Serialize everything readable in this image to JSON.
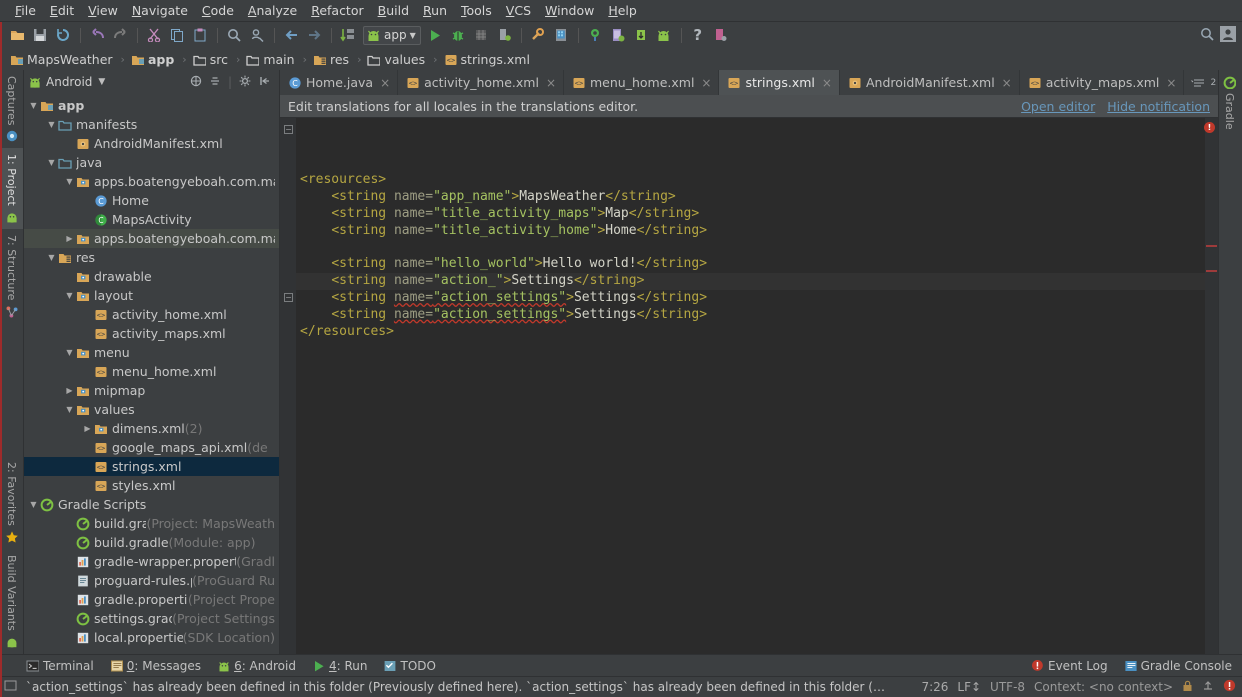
{
  "menu": {
    "items": [
      "File",
      "Edit",
      "View",
      "Navigate",
      "Code",
      "Analyze",
      "Refactor",
      "Build",
      "Run",
      "Tools",
      "VCS",
      "Window",
      "Help"
    ]
  },
  "toolbar": {
    "icons": [
      "open-folder-icon",
      "save-all-icon",
      "sync-icon",
      "undo-icon",
      "redo-icon",
      "cut-icon",
      "copy-icon",
      "paste-icon",
      "find-icon",
      "find-usages-icon",
      "back-icon",
      "forward-icon",
      "compile-icon"
    ],
    "run_config_label": "app",
    "run_icons": [
      "run-icon",
      "debug-icon",
      "coverage-icon",
      "attach-debugger-icon",
      "sdk-manager-icon",
      "avd-manager-icon",
      "sync-gradle-icon",
      "device-monitor-icon",
      "layout-inspector-icon",
      "android-icon",
      "help-icon",
      "project-structure-icon"
    ],
    "search_icon": "search-icon",
    "user_icon": "user-avatar-icon"
  },
  "breadcrumb": {
    "items": [
      {
        "label": "MapsWeather",
        "icon": "module-icon",
        "bold": false
      },
      {
        "label": "app",
        "icon": "module-icon",
        "bold": true
      },
      {
        "label": "src",
        "icon": "folder-icon",
        "bold": false
      },
      {
        "label": "main",
        "icon": "folder-icon",
        "bold": false
      },
      {
        "label": "res",
        "icon": "res-folder-icon",
        "bold": false
      },
      {
        "label": "values",
        "icon": "folder-icon",
        "bold": false
      },
      {
        "label": "strings.xml",
        "icon": "xml-file-icon",
        "bold": false
      }
    ],
    "separator": "›"
  },
  "left_rail": {
    "items": [
      {
        "label": "Captures",
        "icon": "captures-icon",
        "active": false
      },
      {
        "label": "1: Project",
        "icon": "project-icon",
        "active": true
      },
      {
        "label": "7: Structure",
        "icon": "structure-icon",
        "active": false
      },
      {
        "label": "2: Favorites",
        "icon": "favorites-star-icon",
        "active": false
      },
      {
        "label": "Build Variants",
        "icon": "build-variants-icon",
        "active": false
      }
    ]
  },
  "right_rail": {
    "items": [
      {
        "label": "Gradle",
        "icon": "gradle-icon"
      }
    ]
  },
  "project_pane": {
    "view_title": "Android",
    "view_icon": "android-head-icon",
    "tools": [
      "collapse-expand-icon",
      "scroll-from-source-icon",
      "settings-gear-icon",
      "hide-panel-icon"
    ],
    "tree": [
      {
        "depth": 0,
        "twisty": "▼",
        "icon": "module-icon",
        "label": "app",
        "suffix": "",
        "bold": true,
        "state": ""
      },
      {
        "depth": 1,
        "twisty": "▼",
        "icon": "folder-blue-icon",
        "label": "manifests",
        "suffix": "",
        "bold": false,
        "state": ""
      },
      {
        "depth": 2,
        "twisty": "",
        "icon": "manifest-file-icon",
        "label": "AndroidManifest.xml",
        "suffix": "",
        "bold": false,
        "state": ""
      },
      {
        "depth": 1,
        "twisty": "▼",
        "icon": "folder-blue-icon",
        "label": "java",
        "suffix": "",
        "bold": false,
        "state": ""
      },
      {
        "depth": 2,
        "twisty": "▼",
        "icon": "package-icon",
        "label": "apps.boatengyeboah.com.ma",
        "suffix": "",
        "bold": false,
        "state": ""
      },
      {
        "depth": 3,
        "twisty": "",
        "icon": "java-class-icon",
        "label": "Home",
        "suffix": "",
        "bold": false,
        "state": ""
      },
      {
        "depth": 3,
        "twisty": "",
        "icon": "java-activity-icon",
        "label": "MapsActivity",
        "suffix": "",
        "bold": false,
        "state": ""
      },
      {
        "depth": 2,
        "twisty": "▶",
        "icon": "package-icon",
        "label": "apps.boatengyeboah.com.ma",
        "suffix": "",
        "bold": false,
        "state": "sel2"
      },
      {
        "depth": 1,
        "twisty": "▼",
        "icon": "res-folder-icon",
        "label": "res",
        "suffix": "",
        "bold": false,
        "state": ""
      },
      {
        "depth": 2,
        "twisty": "",
        "icon": "folder-res-icon",
        "label": "drawable",
        "suffix": "",
        "bold": false,
        "state": ""
      },
      {
        "depth": 2,
        "twisty": "▼",
        "icon": "folder-res-icon",
        "label": "layout",
        "suffix": "",
        "bold": false,
        "state": ""
      },
      {
        "depth": 3,
        "twisty": "",
        "icon": "xml-file-icon",
        "label": "activity_home.xml",
        "suffix": "",
        "bold": false,
        "state": ""
      },
      {
        "depth": 3,
        "twisty": "",
        "icon": "xml-file-icon",
        "label": "activity_maps.xml",
        "suffix": "",
        "bold": false,
        "state": ""
      },
      {
        "depth": 2,
        "twisty": "▼",
        "icon": "folder-res-icon",
        "label": "menu",
        "suffix": "",
        "bold": false,
        "state": ""
      },
      {
        "depth": 3,
        "twisty": "",
        "icon": "xml-file-icon",
        "label": "menu_home.xml",
        "suffix": "",
        "bold": false,
        "state": ""
      },
      {
        "depth": 2,
        "twisty": "▶",
        "icon": "folder-res-icon",
        "label": "mipmap",
        "suffix": "",
        "bold": false,
        "state": ""
      },
      {
        "depth": 2,
        "twisty": "▼",
        "icon": "folder-res-icon",
        "label": "values",
        "suffix": "",
        "bold": false,
        "state": ""
      },
      {
        "depth": 3,
        "twisty": "▶",
        "icon": "folder-res-icon",
        "label": "dimens.xml",
        "suffix": " (2)",
        "bold": false,
        "state": ""
      },
      {
        "depth": 3,
        "twisty": "",
        "icon": "xml-file-icon",
        "label": "google_maps_api.xml",
        "suffix": " (de",
        "bold": false,
        "state": ""
      },
      {
        "depth": 3,
        "twisty": "",
        "icon": "xml-file-icon",
        "label": "strings.xml",
        "suffix": "",
        "bold": false,
        "state": "sel"
      },
      {
        "depth": 3,
        "twisty": "",
        "icon": "xml-file-icon",
        "label": "styles.xml",
        "suffix": "",
        "bold": false,
        "state": ""
      },
      {
        "depth": 0,
        "twisty": "▼",
        "icon": "gradle-icon",
        "label": "Gradle Scripts",
        "suffix": "",
        "bold": false,
        "state": ""
      },
      {
        "depth": 2,
        "twisty": "",
        "icon": "gradle-icon",
        "label": "build.gradle",
        "suffix": " (Project: MapsWeath",
        "bold": false,
        "state": ""
      },
      {
        "depth": 2,
        "twisty": "",
        "icon": "gradle-icon",
        "label": "build.gradle",
        "suffix": " (Module: app)",
        "bold": false,
        "state": ""
      },
      {
        "depth": 2,
        "twisty": "",
        "icon": "properties-file-icon",
        "label": "gradle-wrapper.properties",
        "suffix": " (Gradl",
        "bold": false,
        "state": ""
      },
      {
        "depth": 2,
        "twisty": "",
        "icon": "text-file-icon",
        "label": "proguard-rules.pro",
        "suffix": " (ProGuard Ru",
        "bold": false,
        "state": ""
      },
      {
        "depth": 2,
        "twisty": "",
        "icon": "properties-file-icon",
        "label": "gradle.properties",
        "suffix": " (Project Prope",
        "bold": false,
        "state": ""
      },
      {
        "depth": 2,
        "twisty": "",
        "icon": "gradle-icon",
        "label": "settings.gradle",
        "suffix": " (Project Settings",
        "bold": false,
        "state": ""
      },
      {
        "depth": 2,
        "twisty": "",
        "icon": "properties-file-icon",
        "label": "local.properties",
        "suffix": " (SDK Location)",
        "bold": false,
        "state": ""
      }
    ]
  },
  "editor": {
    "tabs": [
      {
        "label": "Home.java",
        "icon": "java-class-icon",
        "active": false
      },
      {
        "label": "activity_home.xml",
        "icon": "xml-file-icon",
        "active": false
      },
      {
        "label": "menu_home.xml",
        "icon": "xml-file-icon",
        "active": false
      },
      {
        "label": "strings.xml",
        "icon": "xml-file-icon",
        "active": true
      },
      {
        "label": "AndroidManifest.xml",
        "icon": "manifest-file-icon",
        "active": false
      },
      {
        "label": "activity_maps.xml",
        "icon": "xml-file-icon",
        "active": false
      }
    ],
    "tab_close_glyph": "×",
    "notification": {
      "message": "Edit translations for all locales in the translations editor.",
      "open_editor_label": "Open editor",
      "hide_notification_label": "Hide notification"
    },
    "error_badge": "!",
    "lines": [
      {
        "indent": 0,
        "current": false,
        "parts": [
          {
            "c": "tag",
            "t": "<resources>"
          }
        ]
      },
      {
        "indent": 4,
        "current": false,
        "parts": [
          {
            "c": "tag",
            "t": "<string "
          },
          {
            "c": "attr",
            "t": "name="
          },
          {
            "c": "val",
            "t": "\"app_name\""
          },
          {
            "c": "tag",
            "t": ">"
          },
          {
            "c": "txt",
            "t": "MapsWeather"
          },
          {
            "c": "tag",
            "t": "</string>"
          }
        ]
      },
      {
        "indent": 4,
        "current": false,
        "parts": [
          {
            "c": "tag",
            "t": "<string "
          },
          {
            "c": "attr",
            "t": "name="
          },
          {
            "c": "val",
            "t": "\"title_activity_maps\""
          },
          {
            "c": "tag",
            "t": ">"
          },
          {
            "c": "txt",
            "t": "Map"
          },
          {
            "c": "tag",
            "t": "</string>"
          }
        ]
      },
      {
        "indent": 4,
        "current": false,
        "parts": [
          {
            "c": "tag",
            "t": "<string "
          },
          {
            "c": "attr",
            "t": "name="
          },
          {
            "c": "val",
            "t": "\"title_activity_home\""
          },
          {
            "c": "tag",
            "t": ">"
          },
          {
            "c": "txt",
            "t": "Home"
          },
          {
            "c": "tag",
            "t": "</string>"
          }
        ]
      },
      {
        "indent": 0,
        "current": false,
        "parts": []
      },
      {
        "indent": 4,
        "current": false,
        "parts": [
          {
            "c": "tag",
            "t": "<string "
          },
          {
            "c": "attr",
            "t": "name="
          },
          {
            "c": "val",
            "t": "\"hello_world\""
          },
          {
            "c": "tag",
            "t": ">"
          },
          {
            "c": "txt",
            "t": "Hello world!"
          },
          {
            "c": "tag",
            "t": "</string>"
          }
        ]
      },
      {
        "indent": 4,
        "current": true,
        "parts": [
          {
            "c": "tag",
            "t": "<string "
          },
          {
            "c": "attr",
            "t": "name="
          },
          {
            "c": "val",
            "t": "\"action_\""
          },
          {
            "c": "tag",
            "t": ">"
          },
          {
            "c": "txt",
            "t": "Settings"
          },
          {
            "c": "tag",
            "t": "</string>"
          }
        ]
      },
      {
        "indent": 4,
        "current": false,
        "parts": [
          {
            "c": "tag",
            "t": "<string "
          },
          {
            "c": "attr err",
            "t": "name="
          },
          {
            "c": "val err",
            "t": "\"action_settings\""
          },
          {
            "c": "tag",
            "t": ">"
          },
          {
            "c": "txt",
            "t": "Settings"
          },
          {
            "c": "tag",
            "t": "</string>"
          }
        ]
      },
      {
        "indent": 4,
        "current": false,
        "parts": [
          {
            "c": "tag",
            "t": "<string "
          },
          {
            "c": "attr err",
            "t": "name="
          },
          {
            "c": "val err",
            "t": "\"action_settings\""
          },
          {
            "c": "tag",
            "t": ">"
          },
          {
            "c": "txt",
            "t": "Settings"
          },
          {
            "c": "tag",
            "t": "</string>"
          }
        ]
      },
      {
        "indent": 0,
        "current": false,
        "parts": [
          {
            "c": "tag",
            "t": "</resources>"
          }
        ]
      }
    ]
  },
  "bottom_toolwindows": {
    "items": [
      {
        "label": "Terminal",
        "mnemonic": "",
        "icon": "terminal-icon"
      },
      {
        "label": ": Messages",
        "mnemonic": "0",
        "icon": "messages-icon"
      },
      {
        "label": ": Android",
        "mnemonic": "6",
        "icon": "android-head-icon"
      },
      {
        "label": ": Run",
        "mnemonic": "4",
        "icon": "run-icon"
      },
      {
        "label": "TODO",
        "mnemonic": "",
        "icon": "todo-icon"
      }
    ],
    "right_items": [
      {
        "label": "Event Log",
        "icon": "event-log-icon"
      },
      {
        "label": "Gradle Console",
        "icon": "gradle-console-icon"
      }
    ]
  },
  "statusbar": {
    "memory_icon": "memory-indicator-icon",
    "message": "`action_settings` has already been defined in this folder (Previously defined here). `action_settings` has already been defined in this folder (Previousl..",
    "caret_position": "7:26",
    "line_separator": "LF↕",
    "encoding": "UTF-8",
    "context": "Context: <no context>",
    "lock_icon": "lock-icon",
    "vcs_icon": "vcs-icon",
    "inspection_icon": "inspection-error-icon"
  }
}
